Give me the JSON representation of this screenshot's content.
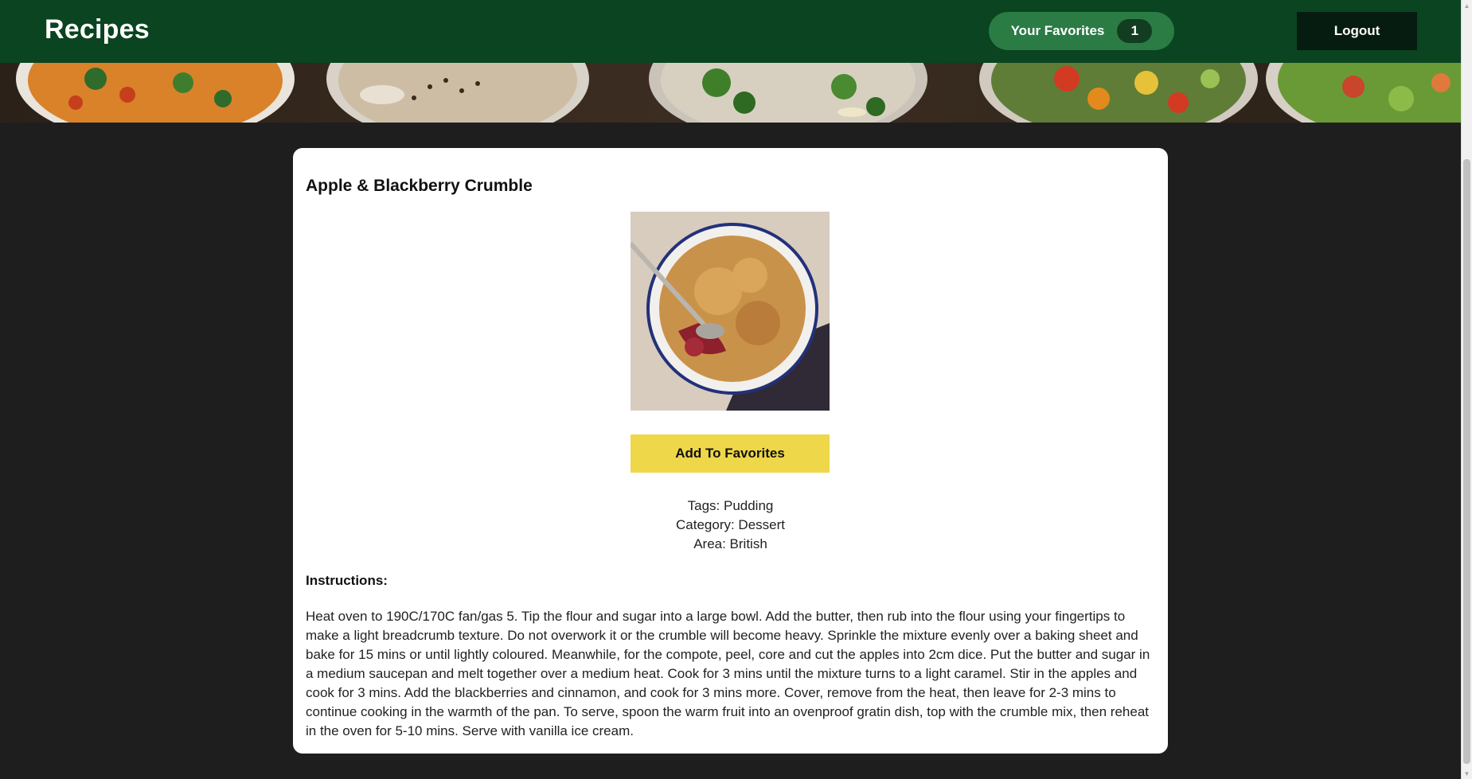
{
  "header": {
    "brand": "Recipes",
    "favorites_label": "Your Favorites",
    "favorites_count": "1",
    "logout_label": "Logout"
  },
  "recipe": {
    "title": "Apple & Blackberry Crumble",
    "add_to_favorites_label": "Add To Favorites",
    "tags_line": "Tags: Pudding",
    "category_line": "Category: Dessert",
    "area_line": "Area: British",
    "instructions_heading": "Instructions:",
    "instructions": "Heat oven to 190C/170C fan/gas 5. Tip the flour and sugar into a large bowl. Add the butter, then rub into the flour using your fingertips to make a light breadcrumb texture. Do not overwork it or the crumble will become heavy. Sprinkle the mixture evenly over a baking sheet and bake for 15 mins or until lightly coloured. Meanwhile, for the compote, peel, core and cut the apples into 2cm dice. Put the butter and sugar in a medium saucepan and melt together over a medium heat. Cook for 3 mins until the mixture turns to a light caramel. Stir in the apples and cook for 3 mins. Add the blackberries and cinnamon, and cook for 3 mins more. Cover, remove from the heat, then leave for 2-3 mins to continue cooking in the warmth of the pan. To serve, spoon the warm fruit into an ovenproof gratin dish, top with the crumble mix, then reheat in the oven for 5-10 mins. Serve with vanilla ice cream."
  },
  "colors": {
    "header_bg": "#0a4420",
    "favorites_pill": "#2b7b45",
    "logout_bg": "#061c10",
    "page_bg": "#1e1e1e",
    "add_button": "#efd74a"
  }
}
